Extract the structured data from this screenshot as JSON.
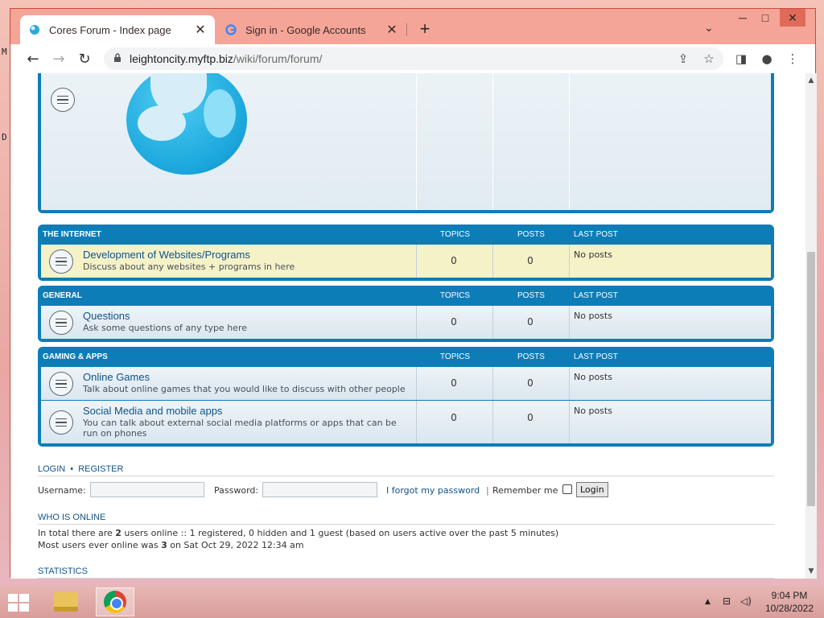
{
  "desktop": {
    "edge_glyph_1": "M",
    "edge_glyph_2": "D"
  },
  "browser": {
    "tabs": [
      {
        "title": "Cores Forum - Index page",
        "favicon": "forum-globe-icon",
        "active": true
      },
      {
        "title": "Sign in - Google Accounts",
        "favicon": "google-g-icon",
        "active": false
      }
    ],
    "new_tab": "+",
    "window_controls": {
      "minimize": "─",
      "maximize": "□",
      "close": "✕"
    },
    "tab_search": "⌄",
    "nav": {
      "back": "←",
      "forward": "→",
      "reload": "↻"
    },
    "url": {
      "host": "leightoncity.myftp.biz",
      "path": "/wiki/forum/forum/"
    },
    "toolbar_icons": {
      "share": "⇪",
      "bookmark": "☆",
      "sidepanel": "◨",
      "profile": "●",
      "menu": "⋮"
    }
  },
  "forum": {
    "categories": [
      {
        "name": "THE INTERNET",
        "col_topics": "TOPICS",
        "col_posts": "POSTS",
        "col_last": "LAST POST",
        "forums": [
          {
            "title": "Development of Websites/Programs",
            "desc": "Discuss about any websites + programs in here",
            "topics": "0",
            "posts": "0",
            "last": "No posts"
          }
        ]
      },
      {
        "name": "GENERAL",
        "col_topics": "TOPICS",
        "col_posts": "POSTS",
        "col_last": "LAST POST",
        "forums": [
          {
            "title": "Questions",
            "desc": "Ask some questions of any type here",
            "topics": "0",
            "posts": "0",
            "last": "No posts"
          }
        ]
      },
      {
        "name": "GAMING & APPS",
        "col_topics": "TOPICS",
        "col_posts": "POSTS",
        "col_last": "LAST POST",
        "forums": [
          {
            "title": "Online Games",
            "desc": "Talk about online games that you would like to discuss with other people",
            "topics": "0",
            "posts": "0",
            "last": "No posts"
          },
          {
            "title": "Social Media and mobile apps",
            "desc": "You can talk about external social media platforms or apps that can be run on phones",
            "topics": "0",
            "posts": "0",
            "last": "No posts"
          }
        ]
      }
    ],
    "login": {
      "heading_login": "LOGIN",
      "heading_sep": "•",
      "heading_register": "REGISTER",
      "username_label": "Username:",
      "username_value": "",
      "password_label": "Password:",
      "password_value": "",
      "forgot": "I forgot my password",
      "separator": "|",
      "remember": "Remember me",
      "button": "Login"
    },
    "who_is_online": {
      "heading": "WHO IS ONLINE",
      "line1_pre": "In total there are ",
      "line1_count": "2",
      "line1_post": " users online :: 1 registered, 0 hidden and 1 guest (based on users active over the past 5 minutes)",
      "line2_pre": "Most users ever online was ",
      "line2_count": "3",
      "line2_post": " on Sat Oct 29, 2022 12:34 am"
    },
    "statistics": {
      "heading": "STATISTICS"
    }
  },
  "taskbar": {
    "tray_icons": {
      "up": "▲",
      "network": "⊟",
      "volume": "◁)"
    },
    "time": "9:04 PM",
    "date": "10/28/2022"
  }
}
